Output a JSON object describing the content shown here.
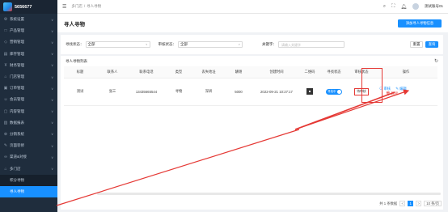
{
  "app": {
    "brand": "5656677"
  },
  "sidebar": {
    "items": [
      {
        "label": "系统设置",
        "icon": "gear-icon",
        "glyph": "⚙"
      },
      {
        "label": "产品管理",
        "icon": "box-icon",
        "glyph": "□"
      },
      {
        "label": "营销管理",
        "icon": "tag-icon",
        "glyph": "◇"
      },
      {
        "label": "库存管理",
        "icon": "stack-icon",
        "glyph": "▤"
      },
      {
        "label": "财务管理",
        "icon": "coin-icon",
        "glyph": "¥"
      },
      {
        "label": "门店管理",
        "icon": "shop-icon",
        "glyph": "⌂"
      },
      {
        "label": "订单管理",
        "icon": "doc-icon",
        "glyph": "▣"
      },
      {
        "label": "会员管理",
        "icon": "user-icon",
        "glyph": "☺"
      },
      {
        "label": "内容管理",
        "icon": "file-icon",
        "glyph": "▢"
      },
      {
        "label": "数据报表",
        "icon": "chart-icon",
        "glyph": "▥"
      },
      {
        "label": "分销系统",
        "icon": "share-icon",
        "glyph": "⊕"
      },
      {
        "label": "页面装修",
        "icon": "brush-icon",
        "glyph": "✎"
      },
      {
        "label": "渠道&对接",
        "icon": "link-icon",
        "glyph": "∞"
      },
      {
        "label": "多门店",
        "icon": "store-icon",
        "glyph": "⌂"
      }
    ],
    "sub_items": [
      {
        "label": "积分寻物"
      },
      {
        "label": "寻人寻物",
        "active": true
      }
    ]
  },
  "topbar": {
    "crumb1": "多门店",
    "crumb2": "寻人寻物",
    "user": "测试账号01"
  },
  "page": {
    "title": "寻人寻物",
    "add_button": "添加寻人寻物信息"
  },
  "filter": {
    "status_label": "寻找状态：",
    "status_value": "全部",
    "audit_label": "审核状态：",
    "audit_value": "全部",
    "keyword_label": "关键字：",
    "keyword_placeholder": "请输入关键字",
    "reset": "重置",
    "search": "查询"
  },
  "list": {
    "title": "寻人寻物列表",
    "columns": [
      "标题",
      "联系人",
      "联系电话",
      "类型",
      "丢失地址",
      "酬谢",
      "创建时间",
      "二维码",
      "寻找状态",
      "审核状态",
      "操作"
    ],
    "rows": [
      {
        "title": "测试",
        "contact": "张三",
        "phone": "13435665544",
        "type": "寻物",
        "address": "深圳",
        "reward": "5000",
        "created": "2022-09-21 10:27:17",
        "find_status": "寻找中",
        "audit_status": "待审核",
        "op_audit": "审核",
        "op_edit": "编辑",
        "op_delete": "删除"
      }
    ]
  },
  "pager": {
    "total": "共 1 条数据",
    "prev": "<",
    "current": "1",
    "next": ">",
    "size": "10 条/页"
  },
  "colors": {
    "accent": "#1890ff",
    "sidebar": "#1f2d3d",
    "annotation": "#e53935"
  }
}
